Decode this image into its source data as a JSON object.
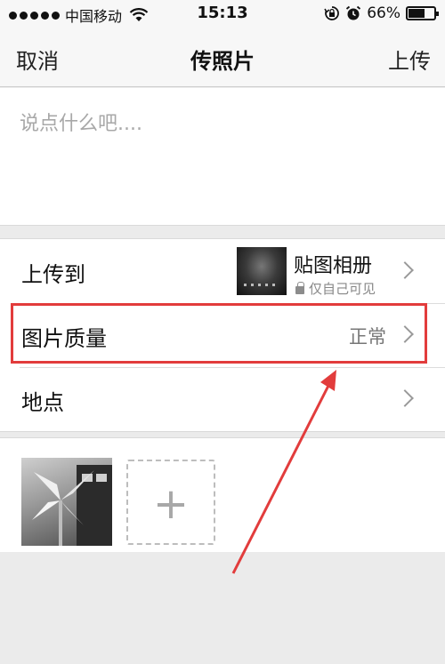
{
  "status_bar": {
    "carrier": "中国移动",
    "time": "15:13",
    "battery_percent": "66%",
    "battery_level": 0.66,
    "icons": [
      "signal-dots-icon",
      "wifi-icon",
      "rotation-lock-icon",
      "alarm-icon",
      "battery-icon"
    ]
  },
  "nav": {
    "cancel_label": "取消",
    "title": "传照片",
    "upload_label": "上传"
  },
  "compose": {
    "placeholder": "说点什么吧...."
  },
  "settings": {
    "upload_to": {
      "label": "上传到",
      "album_name": "贴图相册",
      "privacy": "仅自己可见"
    },
    "quality": {
      "label": "图片质量",
      "value": "正常"
    },
    "location": {
      "label": "地点"
    }
  },
  "photos": {
    "add_label": "+"
  },
  "annotation": {
    "highlight_color": "#e23c3c"
  }
}
